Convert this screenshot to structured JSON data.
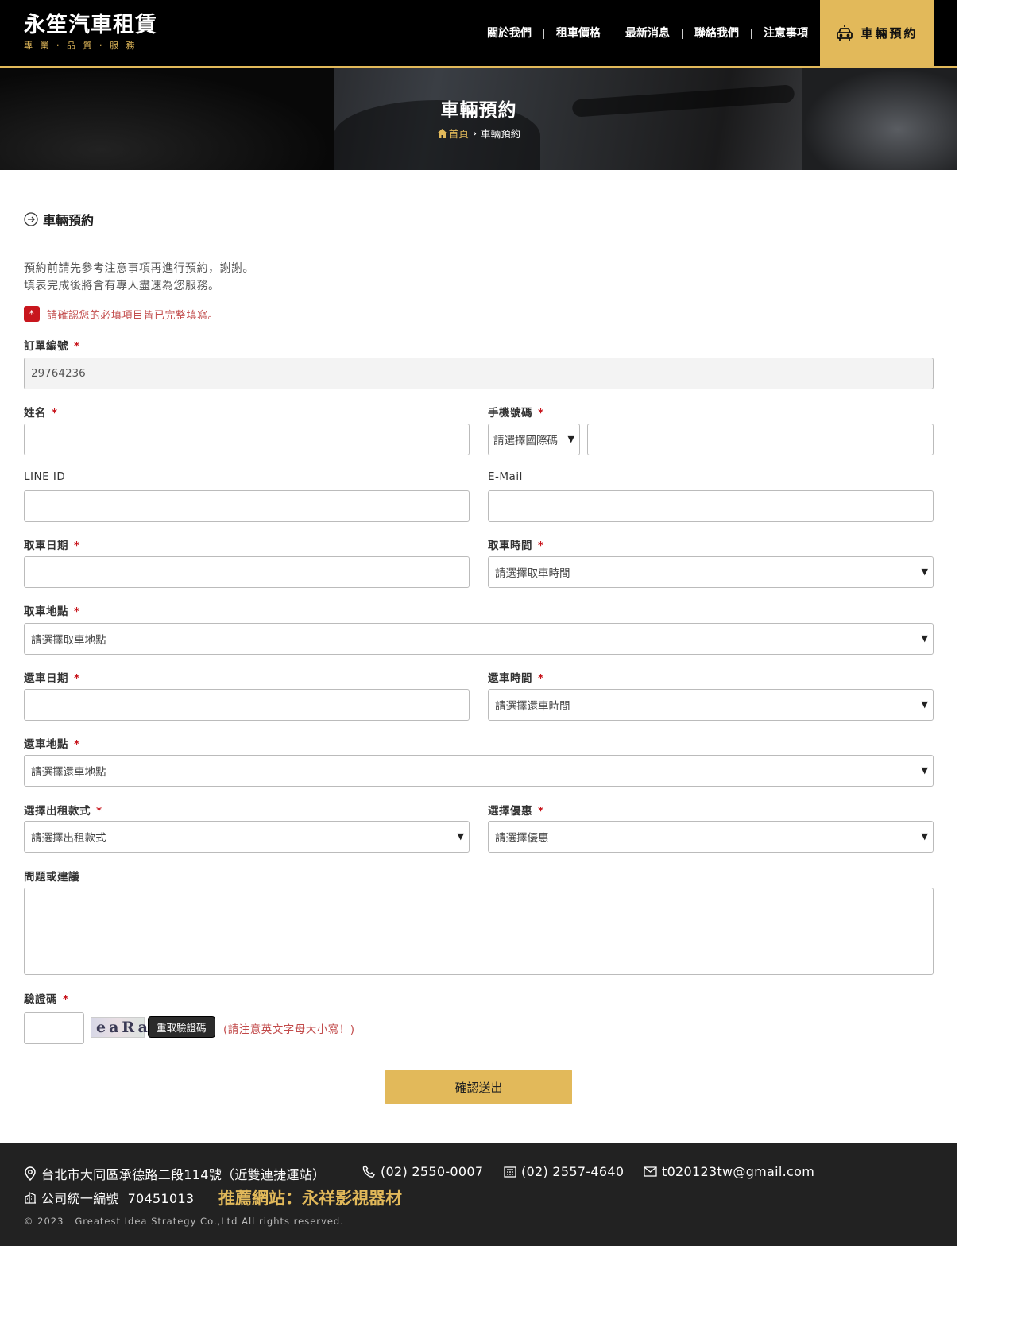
{
  "header": {
    "logo_name": "永笙汽車租賃",
    "logo_tagline": "專 業 · 品 質 · 服 務",
    "nav": [
      "關於我們",
      "租車價格",
      "最新消息",
      "聯絡我們",
      "注意事項"
    ],
    "book_label": "車輛預約",
    "accent_color": "#e2b95a"
  },
  "banner": {
    "title": "車輛預約",
    "breadcrumb_home": "首頁",
    "breadcrumb_current": "車輛預約"
  },
  "form": {
    "section_title": "車輛預約",
    "intro_line1": "預約前請先參考注意事項再進行預約，謝謝。",
    "intro_line2": "填表完成後將會有專人盡速為您服務。",
    "required_star": "*",
    "required_notice": "請確認您的必填項目皆已完整填寫。",
    "order_no_label": "訂單編號",
    "order_no_value": "29764236",
    "name_label": "姓名",
    "phone_label": "手機號碼",
    "phone_country_placeholder": "請選擇國際碼",
    "line_label": "LINE ID",
    "email_label": "E-Mail",
    "pickup_date_label": "取車日期",
    "pickup_time_label": "取車時間",
    "pickup_time_placeholder": "請選擇取車時間",
    "pickup_place_label": "取車地點",
    "pickup_place_placeholder": "請選擇取車地點",
    "return_date_label": "還車日期",
    "return_time_label": "還車時間",
    "return_time_placeholder": "請選擇還車時間",
    "return_place_label": "還車地點",
    "return_place_placeholder": "請選擇還車地點",
    "rental_type_label": "選擇出租款式",
    "rental_type_placeholder": "請選擇出租款式",
    "discount_label": "選擇優惠",
    "discount_placeholder": "請選擇優惠",
    "comments_label": "問題或建議",
    "captcha_label": "驗證碼",
    "captcha_text": "eaRa",
    "captcha_refresh": "重取驗證碼",
    "captcha_hint": "(請注意英文字母大小寫！)",
    "submit_label": "確認送出",
    "caret": "▼"
  },
  "footer": {
    "address": "台北市大同區承德路二段114號（近雙連捷運站）",
    "phone": "(02) 2550-0007",
    "fax": "(02) 2557-4640",
    "email": "t020123tw@gmail.com",
    "tax_id": "公司統一編號  70451013",
    "promo": "推薦網站：永祥影視器材",
    "copyright": "© 2023   Greatest Idea Strategy Co.,Ltd All rights reserved."
  }
}
